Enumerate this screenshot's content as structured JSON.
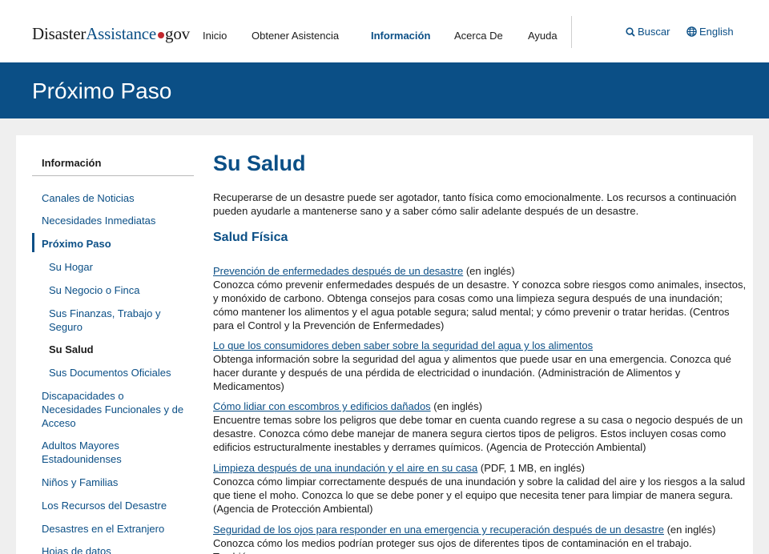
{
  "header": {
    "logo": {
      "part1": "Disaster",
      "part2": "Assistance",
      "part3": "gov"
    },
    "nav": [
      "Inicio",
      "Obtener Asistencia",
      "Información",
      "Acerca De",
      "Ayuda"
    ],
    "search_label": "Buscar",
    "language_label": "English"
  },
  "banner": {
    "title": "Próximo Paso"
  },
  "sidebar": {
    "heading": "Información",
    "items": [
      "Canales de Noticias",
      "Necesidades Inmediatas",
      "Próximo Paso",
      "Su Hogar",
      "Su Negocio o Finca",
      "Sus Finanzas, Trabajo y Seguro",
      "Su Salud",
      "Sus Documentos Oficiales",
      "Discapacidades o Necesidades Funcionales y de Acceso",
      "Adultos Mayores Estadounidenses",
      "Niños y Familias",
      "Los Recursos del Desastre",
      "Desastres en el Extranjero",
      "Hojas de datos"
    ]
  },
  "main": {
    "title": "Su Salud",
    "intro": "Recuperarse de un desastre puede ser agotador, tanto física como emocionalmente. Los recursos a continuación pueden ayudarle a mantenerse sano y a saber cómo salir adelante después de un desastre.",
    "section_heading": "Salud Física",
    "resources": [
      {
        "link": "Prevención de enfermedades después de un desastre",
        "note": " (en inglés)",
        "desc": "Conozca cómo prevenir enfermedades después de un desastre. Y conozca sobre riesgos como animales, insectos, y monóxido de carbono. Obtenga consejos para cosas como una limpieza segura después de una inundación; cómo mantener los alimentos y el agua potable segura; salud mental; y cómo prevenir o tratar heridas. (Centros para el Control y la Prevención de Enfermedades)"
      },
      {
        "link": "Lo que los consumidores deben saber sobre la seguridad del agua y los alimentos",
        "note": "",
        "desc": "Obtenga información sobre la seguridad del agua y alimentos que puede usar en una emergencia. Conozca qué hacer durante y después de una pérdida de electricidad o inundación. (Administración de Alimentos y Medicamentos)"
      },
      {
        "link": "Cómo lidiar con escombros y edificios dañados",
        "note": " (en inglés)",
        "desc": "Encuentre temas sobre los peligros que debe tomar en cuenta cuando regrese a su casa o negocio después de un desastre. Conozca cómo debe manejar de manera segura ciertos tipos de peligros. Estos incluyen cosas como edificios estructuralmente inestables y derrames químicos. (Agencia de Protección Ambiental)"
      },
      {
        "link": "Limpieza después de una inundación y el aire en su casa",
        "note": " (PDF, 1 MB, en inglés)",
        "desc": "Conozca cómo limpiar correctamente después de una inundación y sobre la calidad del aire y los riesgos a la salud que tiene el moho. Conozca lo que se debe poner y el equipo que necesita tener para limpiar de manera segura. (Agencia de Protección Ambiental)"
      },
      {
        "link": "Seguridad de los ojos para responder en una emergencia y recuperación después de un desastre",
        "note": " (en inglés)",
        "desc": "Conozca cómo los medios podrían proteger sus ojos de diferentes tipos de contaminación en el trabajo. También"
      }
    ]
  },
  "colors": {
    "primary": "#0b4f86",
    "logo_dot": "#c1272d",
    "page_bg": "#efefef"
  }
}
